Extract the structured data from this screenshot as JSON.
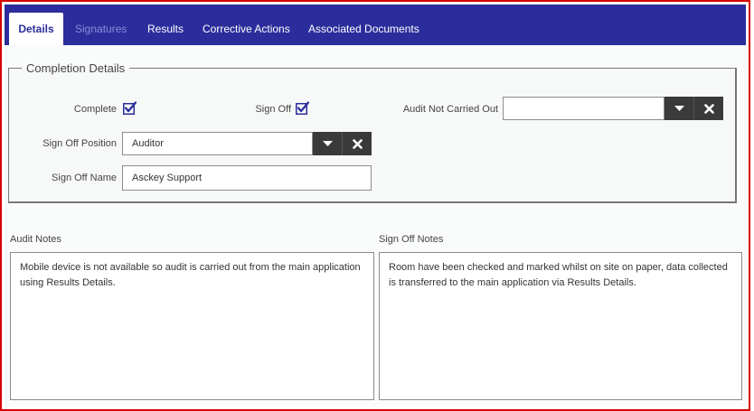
{
  "tabs": [
    {
      "label": "Details",
      "state": "active"
    },
    {
      "label": "Signatures",
      "state": "disabled"
    },
    {
      "label": "Results",
      "state": "normal"
    },
    {
      "label": "Corrective Actions",
      "state": "normal"
    },
    {
      "label": "Associated Documents",
      "state": "normal"
    }
  ],
  "completion": {
    "legend": "Completion Details",
    "complete_label": "Complete",
    "complete_checked": true,
    "sign_off_label": "Sign Off",
    "sign_off_checked": true,
    "audit_not_carried_out_label": "Audit Not Carried Out",
    "audit_not_carried_out_value": "",
    "sign_off_position_label": "Sign Off Position",
    "sign_off_position_value": "Auditor",
    "sign_off_name_label": "Sign Off Name",
    "sign_off_name_value": "Asckey Support"
  },
  "notes": {
    "audit_label": "Audit Notes",
    "audit_text": "Mobile device is not available so audit is carried out from the main application using Results Details.",
    "sign_off_label": "Sign Off Notes",
    "sign_off_text": "Room have been checked and marked whilst on site on paper, data collected is transferred to the main application via Results Details."
  },
  "colors": {
    "tabbar": "#2b2d9c",
    "frame_border": "#d40000",
    "checkmark": "#2b2d9c",
    "combo_button": "#3a3a3a"
  },
  "icons": {
    "checkbox": "checkbox-checked-icon",
    "dropdown": "caret-down-icon",
    "clear": "close-icon"
  }
}
